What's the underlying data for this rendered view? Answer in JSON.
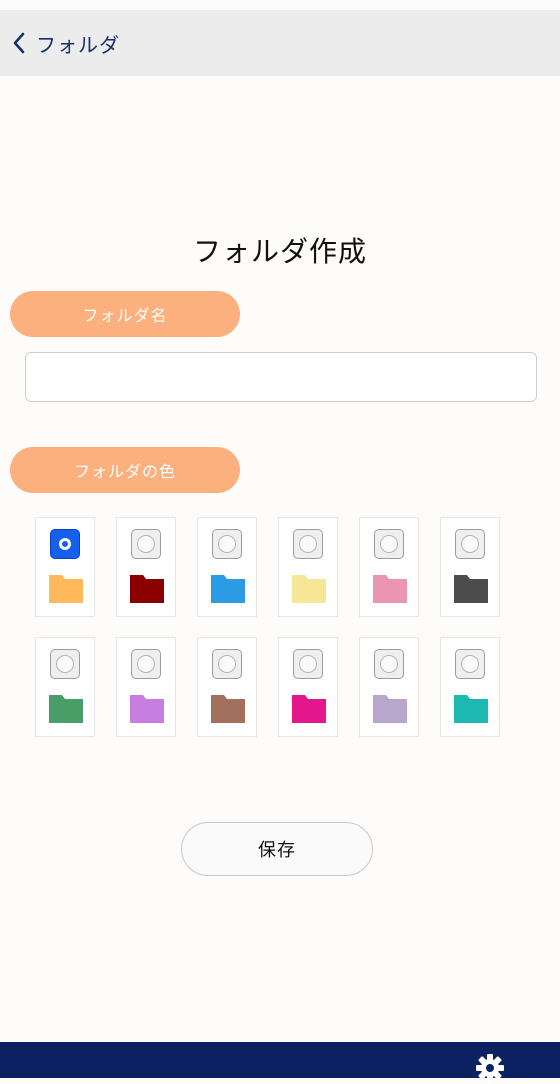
{
  "header": {
    "back_label": "フォルダ"
  },
  "page_title": "フォルダ作成",
  "form": {
    "name_label": "フォルダ名",
    "name_value": "",
    "name_placeholder": "",
    "color_label": "フォルダの色",
    "save_label": "保存"
  },
  "colors": [
    {
      "color": "#ffb95b",
      "selected": true
    },
    {
      "color": "#8b0000",
      "selected": false
    },
    {
      "color": "#2b9be4",
      "selected": false
    },
    {
      "color": "#f6e797",
      "selected": false
    },
    {
      "color": "#ea96b3",
      "selected": false
    },
    {
      "color": "#4c4c4c",
      "selected": false
    },
    {
      "color": "#489e66",
      "selected": false
    },
    {
      "color": "#c67ee1",
      "selected": false
    },
    {
      "color": "#a2705d",
      "selected": false
    },
    {
      "color": "#e3178b",
      "selected": false
    },
    {
      "color": "#b9a6cc",
      "selected": false
    },
    {
      "color": "#1db9b1",
      "selected": false
    }
  ],
  "footer": {
    "icon": "gear-icon"
  }
}
